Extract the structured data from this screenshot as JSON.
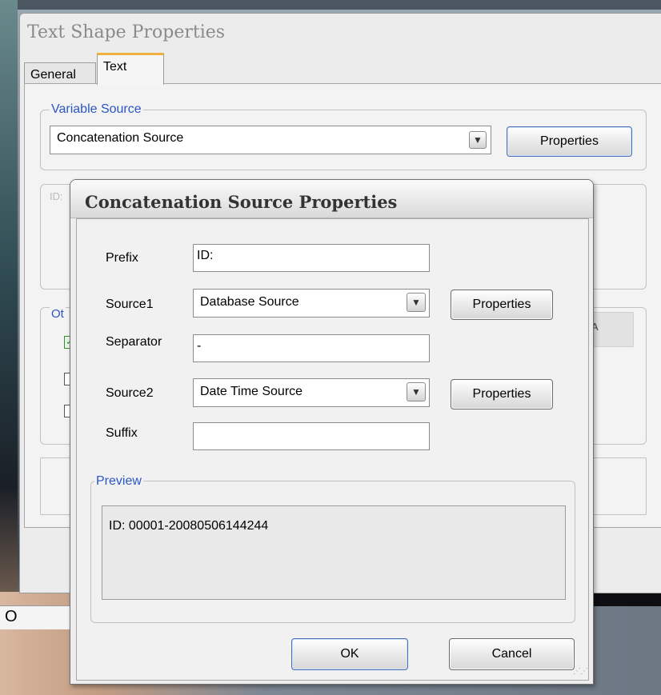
{
  "background": {
    "field_text": "O"
  },
  "main_window": {
    "title": "Text Shape Properties",
    "tabs": [
      {
        "label": "General"
      },
      {
        "label": "Text"
      }
    ],
    "variable_source": {
      "legend": "Variable Source",
      "selected": "Concatenation Source",
      "properties_label": "Properties"
    },
    "preview_field_partial": "ID:",
    "other_group_partial": "Ot",
    "right_partial": "A"
  },
  "dialog": {
    "title": "Concatenation Source Properties",
    "prefix": {
      "label": "Prefix",
      "value": "ID:"
    },
    "source1": {
      "label": "Source1",
      "selected": "Database Source",
      "properties_label": "Properties"
    },
    "separator": {
      "label": "Separator",
      "value": "-"
    },
    "source2": {
      "label": "Source2",
      "selected": "Date Time Source",
      "properties_label": "Properties"
    },
    "suffix": {
      "label": "Suffix",
      "value": ""
    },
    "preview": {
      "legend": "Preview",
      "text": "ID:  00001-20080506144244"
    },
    "ok_label": "OK",
    "cancel_label": "Cancel"
  },
  "colors": {
    "legend_blue": "#2a56c6",
    "tab_accent": "#f0b040"
  }
}
